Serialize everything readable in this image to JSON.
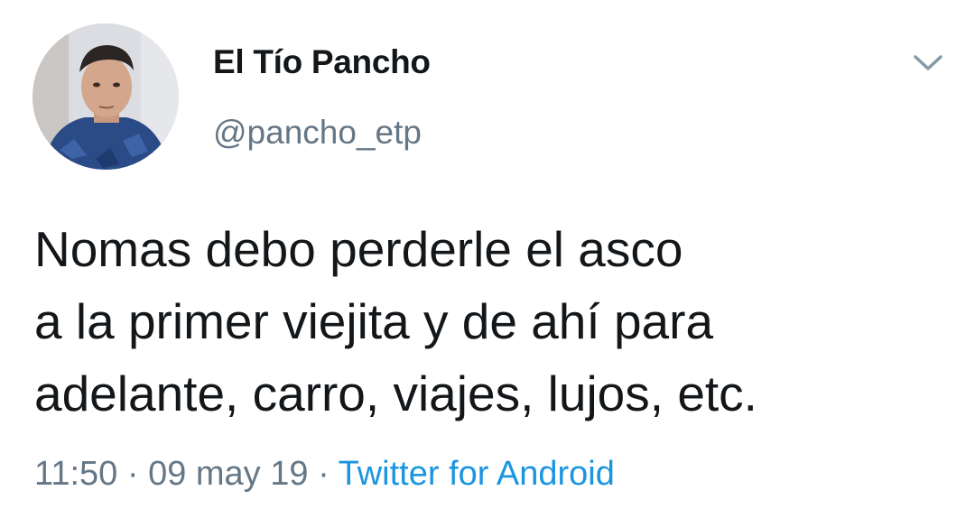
{
  "author": {
    "display_name": "El Tío Pancho",
    "handle": "@pancho_etp",
    "avatar_icon": "profile-photo"
  },
  "tweet": {
    "text": "Nomas debo perderle el asco\na la primer viejita y de ahí para\nadelante, carro, viajes, lujos, etc."
  },
  "meta": {
    "time": "11:50",
    "separator": " · ",
    "date": "09 may 19",
    "source": "Twitter for Android"
  },
  "controls": {
    "menu_icon": "chevron-down-icon"
  },
  "colors": {
    "text": "#14171a",
    "secondary": "#657786",
    "link": "#1b95e0",
    "background": "#ffffff"
  }
}
